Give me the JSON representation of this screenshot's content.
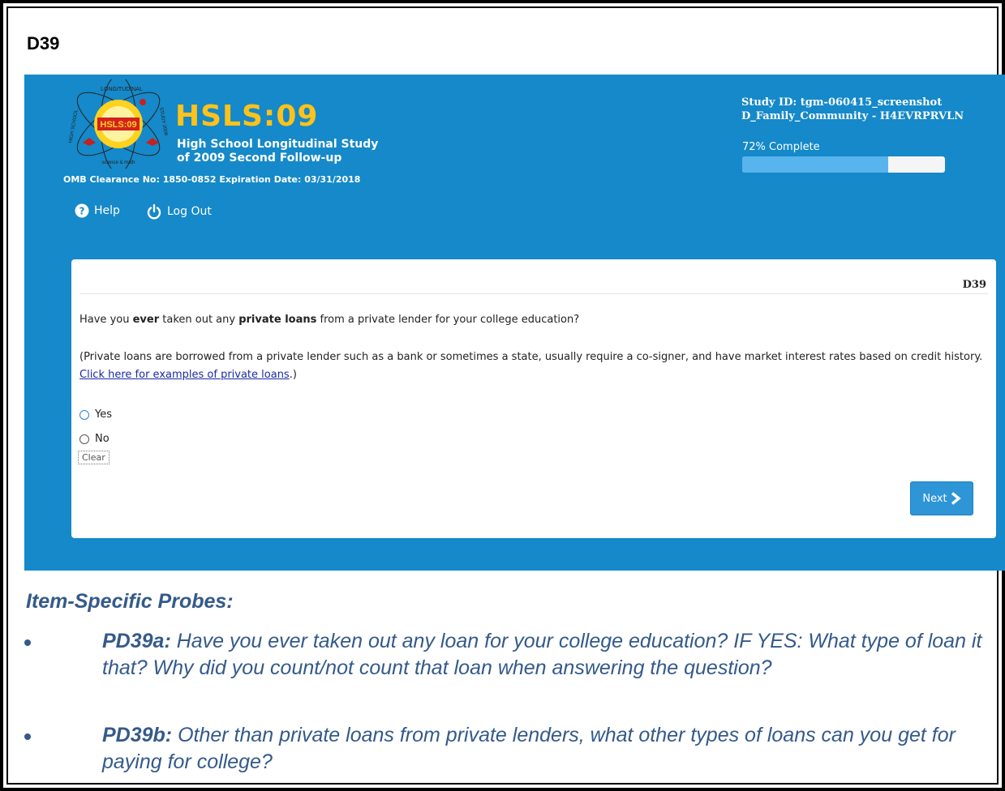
{
  "page": {
    "heading": "D39"
  },
  "app": {
    "brand": {
      "emblem_center": "HSLS:09",
      "emblem_ring_top": "LONGITUDINAL",
      "emblem_ring_left": "HIGH SCHOOL",
      "emblem_ring_right": "STUDY 2009",
      "emblem_ring_bottom": "science & math",
      "title": "HSLS:09",
      "subtitle_line1": "High School Longitudinal Study",
      "subtitle_line2": "of 2009 Second Follow-up",
      "omb": "OMB Clearance No: 1850-0852 Expiration Date: 03/31/2018"
    },
    "study": {
      "id_line": "Study ID: tgm-060415_screenshot",
      "section_line": "D_Family_Community - H4EVRPRVLN"
    },
    "progress": {
      "label": "72% Complete",
      "percent": 72
    },
    "nav": {
      "help": "Help",
      "logout": "Log Out"
    },
    "card": {
      "qid": "D39",
      "question_pre": "Have you ",
      "question_b1": "ever",
      "question_mid": " taken out any ",
      "question_b2": "private loans",
      "question_post": " from a private lender for your college education?",
      "note_pre": "(Private loans are borrowed from a private lender such as a bank or sometimes a state, usually require a co-signer, and have market interest rates based on credit history. ",
      "note_link": "Click here for examples of private loans",
      "note_post": ".)",
      "options": [
        "Yes",
        "No"
      ],
      "clear": "Clear",
      "next": "Next"
    }
  },
  "probes": {
    "title": "Item-Specific Probes:",
    "items": [
      {
        "id": "PD39a:",
        "text": " Have you ever taken out any loan for your college education? IF YES: What type of loan it that? Why did you count/not count that loan when answering the question?"
      },
      {
        "id": "PD39b:",
        "text": " Other than private loans from private lenders, what other types of loans can you get for paying for college?"
      }
    ]
  },
  "colors": {
    "app_bg": "#1589c9",
    "brand_yellow": "#ffc21a",
    "probe_text": "#345a8a",
    "progress_fill": "#58b4ec"
  }
}
